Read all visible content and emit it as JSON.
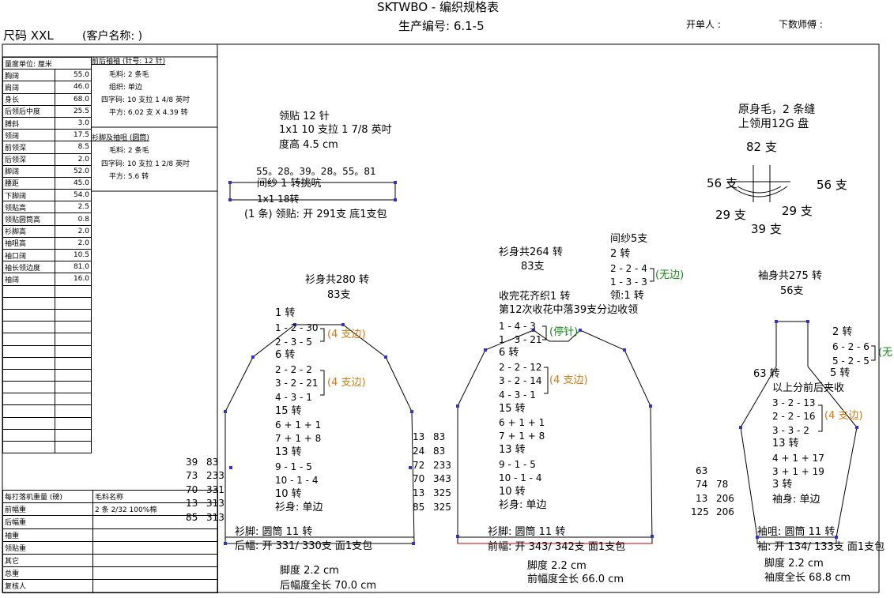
{
  "header": {
    "title": "SKTWBO - 编织规格表",
    "size": "尺码 XXL",
    "customer": "(客户名称: )",
    "prod_no": "生产编号: 6.1-5",
    "opener": "开单人 :",
    "counter": "下数师傅 :"
  },
  "measure": {
    "header": "量度单位: 厘米",
    "rows": [
      {
        "label": "胸阔",
        "value": "55.0"
      },
      {
        "label": "肩阔",
        "value": "46.0"
      },
      {
        "label": "身长",
        "value": "68.0"
      },
      {
        "label": "后领后中度",
        "value": "25.5"
      },
      {
        "label": "膊斜",
        "value": "3.0"
      },
      {
        "label": "领阔",
        "value": "17.5"
      },
      {
        "label": "前领深",
        "value": "8.5"
      },
      {
        "label": "后领深",
        "value": "2.0"
      },
      {
        "label": "脚阔",
        "value": "52.0"
      },
      {
        "label": "腰距",
        "value": "45.0"
      },
      {
        "label": "下脚阔",
        "value": "54.0"
      },
      {
        "label": "领贴高",
        "value": "2.5"
      },
      {
        "label": "领贴圆筒高",
        "value": "0.8"
      },
      {
        "label": "衫脚高",
        "value": "2.0"
      },
      {
        "label": "袖咀高",
        "value": "2.0"
      },
      {
        "label": "袖口阔",
        "value": "10.5"
      },
      {
        "label": "袖长领边度",
        "value": "81.0"
      },
      {
        "label": "袖阔",
        "value": "16.0"
      }
    ]
  },
  "spec1": {
    "title": "前后袖袖 (针号: 12 针)",
    "lines": [
      "毛料: 2 条毛",
      "组织: 单边",
      "四字码: 10 支拉 1 4/8 英吋",
      "平方: 6.02 支 X  4.39 转"
    ]
  },
  "spec2": {
    "title": "衫脚及袖咀 (圆筒)",
    "lines": [
      "毛料: 2 条毛",
      "四字码: 10 支拉 1 2/8 英吋",
      "平方: 5.6 转"
    ]
  },
  "bottom_table": {
    "header_label": "每打落机重量 (磅)",
    "header_value": "毛料名称",
    "first_value": "2 条 2/32  100%棉",
    "rows": [
      "前幅重",
      "后幅重",
      "袖重",
      "领贴重",
      "其它",
      "总重",
      "复核人"
    ]
  },
  "collar": {
    "l1": "领贴  12 针",
    "l2": "1x1   10 支拉 1 7/8 英吋",
    "l3": "度高 4.5 cm",
    "nums": "55。28。39。28。55。81",
    "l4": "间纱 1 转挑吭",
    "l5": "1x1       18转",
    "l6": "(1 条) 领贴: 开 291支 底1支包"
  },
  "note": {
    "l1": "原身毛，2 条缝",
    "l2": "上领用12G 盘",
    "n82": "82 支",
    "n56a": "56 支",
    "n56b": "56 支",
    "n29a": "29 支",
    "n29b": "29 支",
    "n39": "39 支"
  },
  "back": {
    "title": "衫身共280 转",
    "sub": "83支",
    "lines": [
      "1 转",
      "1 - 2 - 30",
      "2 - 3 - 5",
      "6 转",
      "2 - 2 - 2",
      "3 - 2 - 21",
      "4 - 3 - 1",
      "15 转",
      "6 + 1 + 1",
      "7 + 1 + 8",
      "13 转",
      "9 - 1 - 5",
      "10 - 1 - 4",
      "10 转",
      "衫身: 单边"
    ],
    "tag1": "(4 支边)",
    "tag2": "(4 支边)",
    "hem": "衫脚: 圆筒  11 转",
    "open": "后幅: 开 331/ 330支 面1支包",
    "h1": "脚度 2.2 cm",
    "h2": "后幅度全长 70.0 cm",
    "leftnums": [
      [
        "39",
        "83"
      ],
      [
        "73",
        "233"
      ],
      [
        "70",
        "331"
      ],
      [
        "13",
        "313"
      ],
      [
        "85",
        "313"
      ]
    ],
    "rightnums": [
      [
        "13",
        "83"
      ],
      [
        "24",
        "83"
      ],
      [
        "72",
        "233"
      ],
      [
        "70",
        "343"
      ],
      [
        "13",
        "325"
      ],
      [
        "85",
        "325"
      ]
    ]
  },
  "front": {
    "top": [
      "间纱5支",
      "2 转",
      "2 - 2 - 4",
      "1 - 3 - 3"
    ],
    "no_edge": "(无边)",
    "title": "衫身共264 转",
    "sub": "83支",
    "neck": "领:1 转",
    "f1": "收完花齐织1 转",
    "f2": "第12次收花中落39支分边收领",
    "lines": [
      "1 - 4 - 3",
      "1 - 3 - 21",
      "6 转",
      "2 - 2 - 12",
      "3 - 2 - 14",
      "4 - 3 - 1",
      "15 转",
      "6 + 1 + 1",
      "7 + 1 + 8",
      "13 转",
      "9 - 1 - 5",
      "10 - 1 - 4",
      "10 转",
      "衫身: 单边"
    ],
    "stop": "(停针)",
    "tag": "(4 支边)",
    "hem": "衫脚: 圆筒  11 转",
    "open": "前幅: 开 343/ 342支 面1支包",
    "h1": "脚度 2.2 cm",
    "h2": "前幅度全长 66.0 cm"
  },
  "sleeve": {
    "title": "袖身共275 转",
    "sub": "56支",
    "r1": "2 转",
    "r2": "6 - 2 - 6",
    "r3": "5 - 2 - 5",
    "no_edge": "(无",
    "r4": "5 转",
    "n63": "63 转",
    "r5": "以上分前后夹收",
    "lines": [
      "3 - 2 - 13",
      "2 - 2 - 16",
      "3 - 3 - 2",
      "13 转",
      "4 + 1 + 17",
      "3 + 1 + 19",
      "3 转",
      "袖身: 单边"
    ],
    "tag": "(4 支边)",
    "leftnums": [
      [
        "63",
        ""
      ],
      [
        "74",
        "78"
      ],
      [
        "13",
        "206"
      ],
      [
        "125",
        "206"
      ]
    ],
    "hem": "袖咀: 圆筒  11 转",
    "open": "袖: 开 134/ 133支 面1支包",
    "h1": "脚度 2.2 cm",
    "h2": "袖度全长 68.8 cm"
  }
}
